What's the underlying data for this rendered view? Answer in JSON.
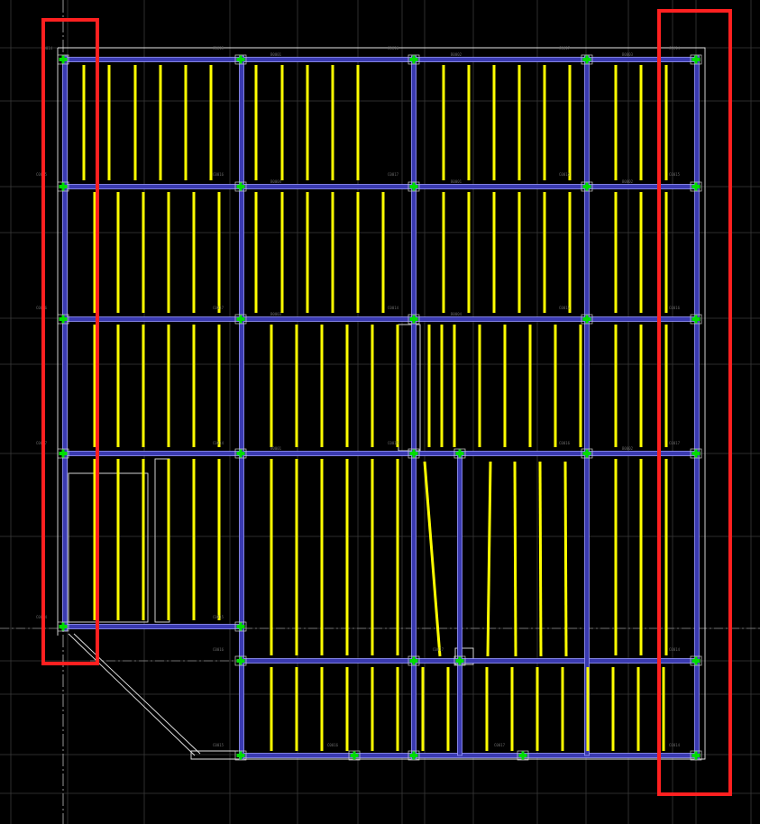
{
  "drawing": {
    "type": "structural framing plan",
    "background_color": "#000000",
    "grid_line_color": "#3a3a3a",
    "beam_outline_color": "#9a9aff",
    "beam_fill_color": "#3a3ab0",
    "joist_color": "#ffff00",
    "column_color": "#00dd00",
    "outline_color": "#e6e6e6",
    "highlight_color": "#ff2020",
    "column_tag_labels": [
      "C0014",
      "C0015",
      "C0016",
      "C0017"
    ],
    "beam_tag_labels": [
      "B0001",
      "B0002",
      "B0003",
      "B0004"
    ],
    "highlights": [
      "left-column-strip",
      "right-column-strip"
    ]
  }
}
